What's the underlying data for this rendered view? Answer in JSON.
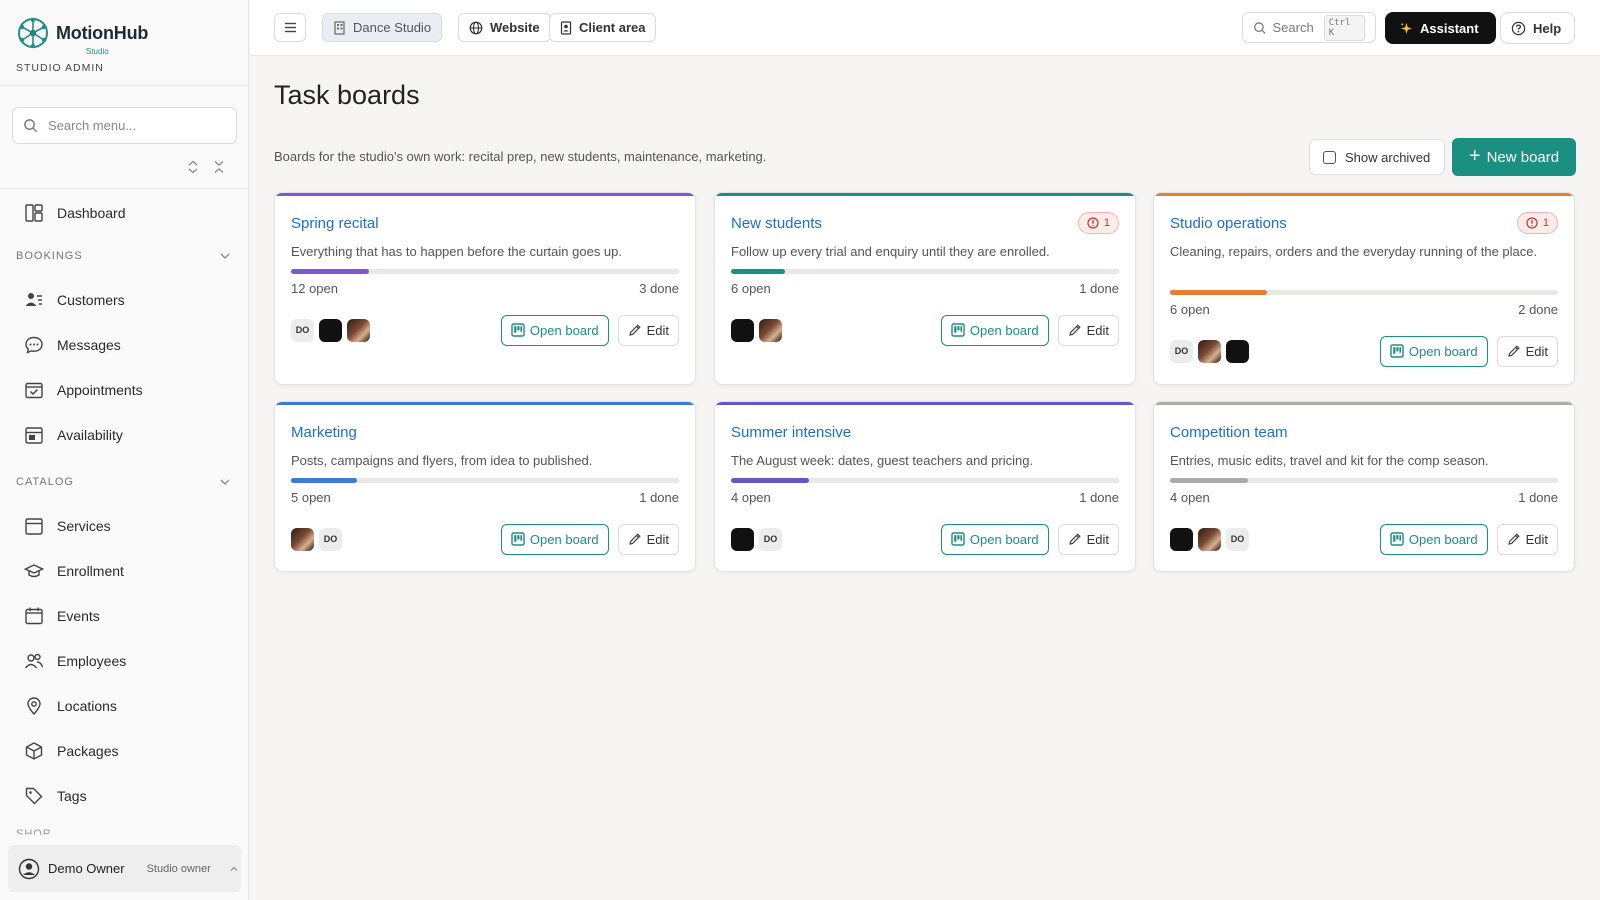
{
  "brand": {
    "name": "MotionHub",
    "sub": "Studio",
    "role": "STUDIO ADMIN"
  },
  "sidebar": {
    "search_placeholder": "Search menu...",
    "dashboard": "Dashboard",
    "sections": [
      {
        "title": "BOOKINGS",
        "items": [
          "Customers",
          "Messages",
          "Appointments",
          "Availability"
        ]
      },
      {
        "title": "CATALOG",
        "items": [
          "Services",
          "Enrollment",
          "Events",
          "Employees",
          "Locations",
          "Packages",
          "Tags"
        ]
      }
    ],
    "cutoff_section": "SHOP",
    "user": {
      "name": "Demo Owner",
      "role": "Studio owner"
    }
  },
  "topbar": {
    "studio": "Dance Studio",
    "website": "Website",
    "client_area": "Client area",
    "search": "Search",
    "shortcut": "Ctrl K",
    "assistant": "Assistant",
    "help": "Help"
  },
  "main": {
    "title": "Task boards",
    "description": "Boards for the studio's own work: recital prep, new students, maintenance, marketing.",
    "show_archived": "Show archived",
    "new_board": "New board",
    "open_label": "Open board",
    "edit_label": "Edit",
    "boards": [
      {
        "title": "Spring recital",
        "description": "Everything that has to happen before the curtain goes up.",
        "open": "12 open",
        "done": "3 done",
        "progress": 0.2,
        "accent": "#7b57d1",
        "alert": null,
        "avatars": [
          "DO",
          "dark",
          "photo"
        ]
      },
      {
        "title": "New students",
        "description": "Follow up every trial and enquiry until they are enrolled.",
        "open": "6 open",
        "done": "1 done",
        "progress": 0.14,
        "accent": "#1a8f82",
        "alert": "1",
        "avatars": [
          "dark",
          "photo"
        ]
      },
      {
        "title": "Studio operations",
        "description": "Cleaning, repairs, orders and the everyday running of the place.",
        "open": "6 open",
        "done": "2 done",
        "progress": 0.25,
        "accent": "#e67e34",
        "alert": "1",
        "avatars": [
          "DO",
          "photo",
          "dark"
        ]
      },
      {
        "title": "Marketing",
        "description": "Posts, campaigns and flyers, from idea to published.",
        "open": "5 open",
        "done": "1 done",
        "progress": 0.17,
        "accent": "#3a7bd5",
        "alert": null,
        "avatars": [
          "photo",
          "DO"
        ]
      },
      {
        "title": "Summer intensive",
        "description": "The August week: dates, guest teachers and pricing.",
        "open": "4 open",
        "done": "1 done",
        "progress": 0.2,
        "accent": "#6a55c8",
        "alert": null,
        "avatars": [
          "dark",
          "DO"
        ]
      },
      {
        "title": "Competition team",
        "description": "Entries, music edits, travel and kit for the comp season.",
        "open": "4 open",
        "done": "1 done",
        "progress": 0.2,
        "accent": "#b0aaa4",
        "alert": null,
        "avatars": [
          "dark",
          "photo",
          "DO"
        ]
      }
    ]
  },
  "colors": {
    "accent": "#1a8f82",
    "link": "#1d6fc9",
    "alert": "#c0392b"
  }
}
